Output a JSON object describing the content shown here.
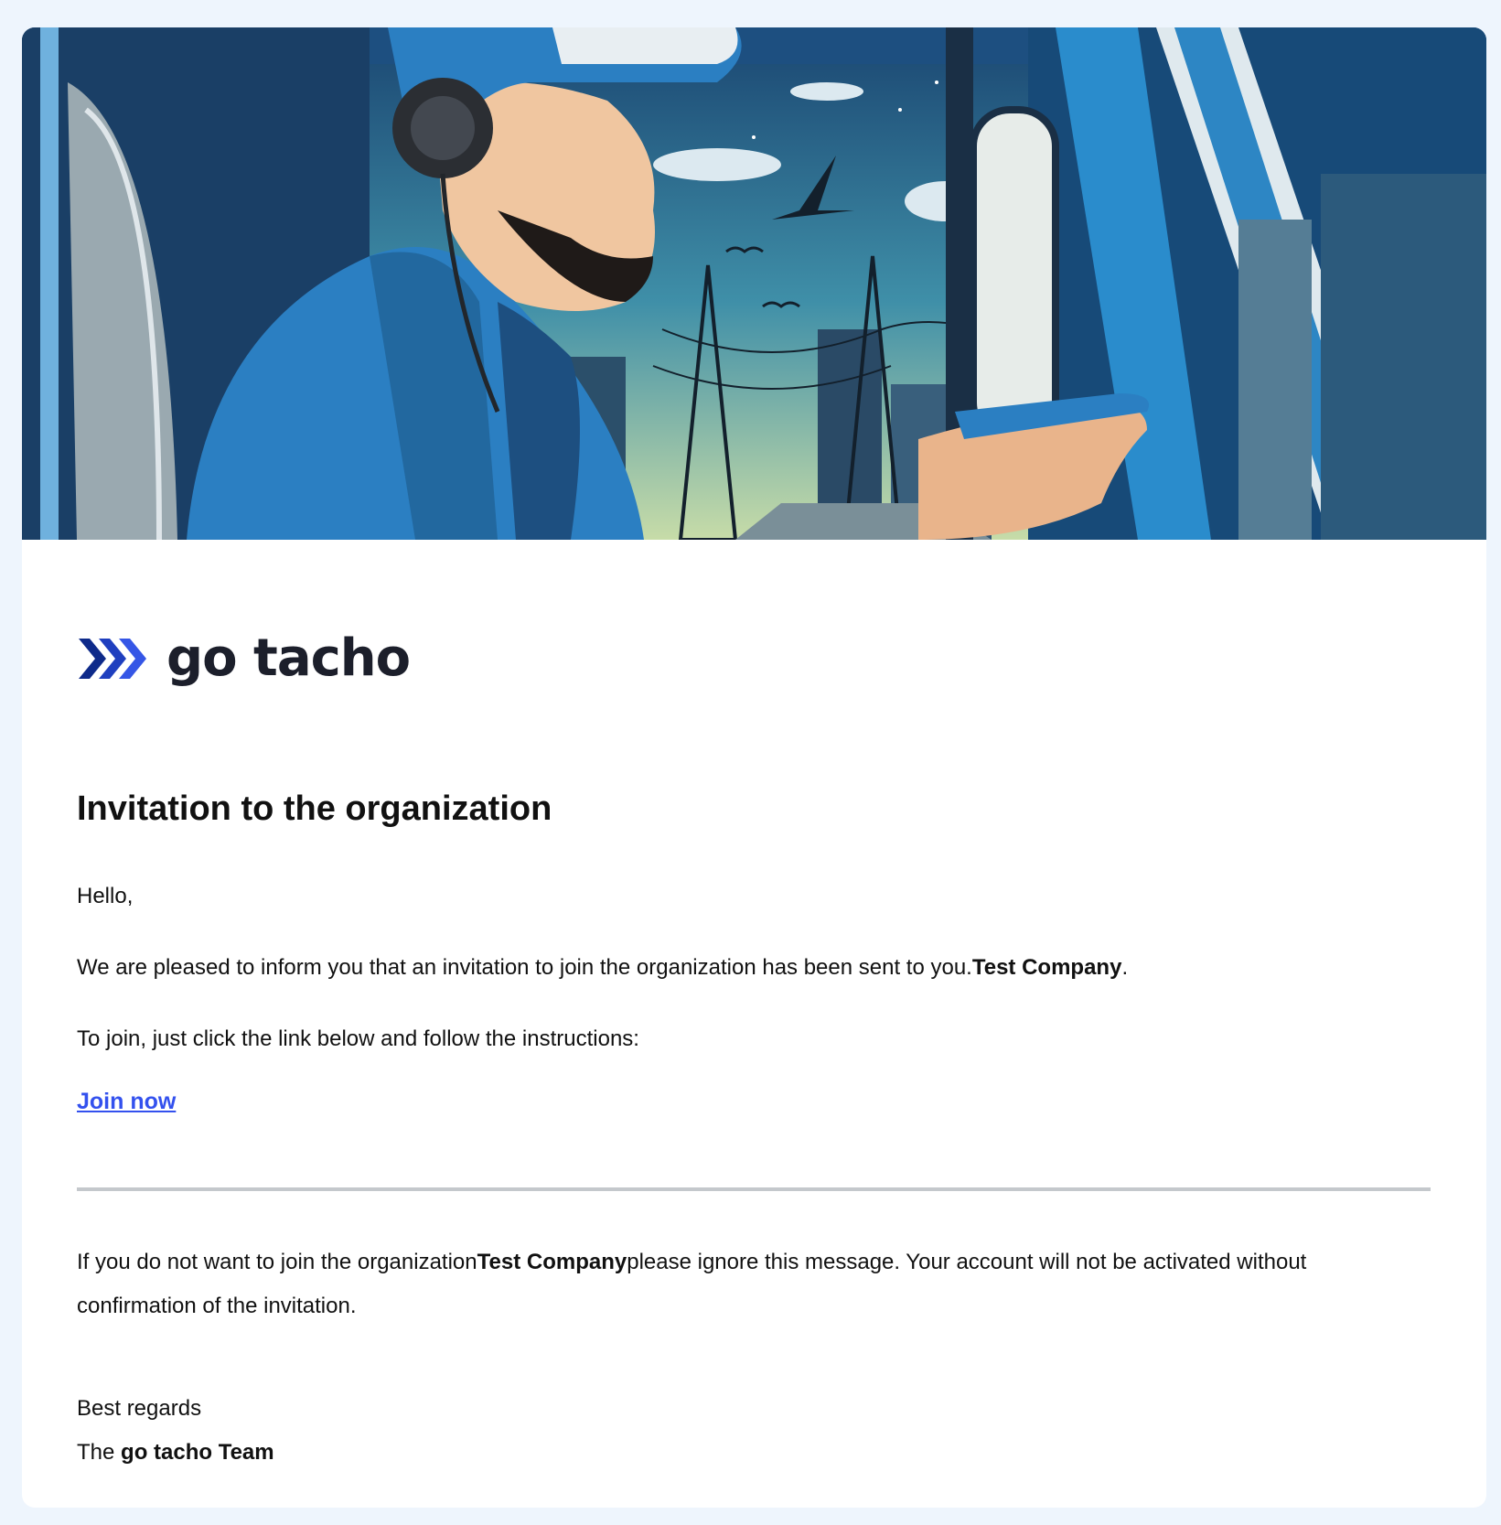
{
  "brand": {
    "name": "go tacho",
    "accent": "#2a46c8",
    "text_color": "#1c1f2b"
  },
  "hero": {
    "image": "illustration of truck driver with headset driving at dusk past power lines and city"
  },
  "email": {
    "title": "Invitation to the organization",
    "greeting": "Hello,",
    "info_text": "We are pleased to inform you that an invitation to join the organization has been sent to you.",
    "company": "Test Company",
    "info_suffix": ".",
    "instructions": "To join, just click the link below and follow the instructions:",
    "join_link": "Join now",
    "ignore_prefix": "If you do not want to join the organization",
    "ignore_suffix": "please ignore this message. Your account will not be activated without confirmation of the invitation.",
    "regards": "Best regards",
    "team_prefix": "The ",
    "team_name": "go tacho Team"
  },
  "colors": {
    "page_bg": "#eef5fd",
    "link": "#3351ee",
    "divider": "#c4c8cc"
  }
}
